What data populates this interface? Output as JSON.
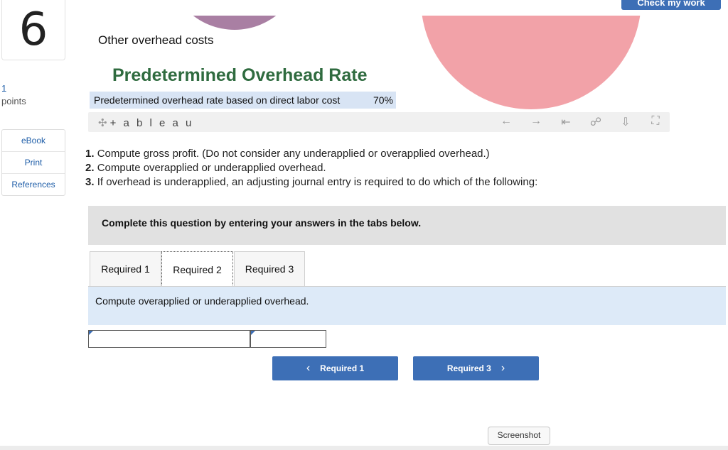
{
  "question": {
    "number": "6",
    "points_value": "1",
    "points_label": "points"
  },
  "sidebar": {
    "links": [
      "eBook",
      "Print",
      "References"
    ]
  },
  "header": {
    "check_button": "Check my work"
  },
  "content": {
    "other_costs": "Other overhead costs",
    "title": "Predetermined Overhead Rate",
    "rate_label": "Predetermined overhead rate based on direct labor cost",
    "rate_value": "70%",
    "tableau_logo": "+ a b l e a u"
  },
  "instructions": [
    {
      "num": "1.",
      "text": "Compute gross profit. (Do not consider any underapplied or overapplied overhead.)"
    },
    {
      "num": "2.",
      "text": "Compute overapplied or underapplied overhead."
    },
    {
      "num": "3.",
      "text": "If overhead is underapplied, an adjusting journal entry is required to do which of the following:"
    }
  ],
  "complete_text": "Complete this question by entering your answers in the tabs below.",
  "tabs": [
    "Required 1",
    "Required 2",
    "Required 3"
  ],
  "active_tab": "Required 2",
  "panel_text": "Compute overapplied or underapplied overhead.",
  "nav": {
    "prev_label": "Required 1",
    "next_label": "Required 3"
  },
  "screenshot_label": "Screenshot",
  "colors": {
    "accent": "#3d6fb6",
    "title_green": "#2f6b3f",
    "pink": "#f2a2a8",
    "purple": "#a97fa3"
  },
  "icons": [
    "crosshair-icon",
    "arrow-left-icon",
    "arrow-right-icon",
    "skip-first-icon",
    "share-icon",
    "download-icon",
    "fullscreen-icon"
  ]
}
